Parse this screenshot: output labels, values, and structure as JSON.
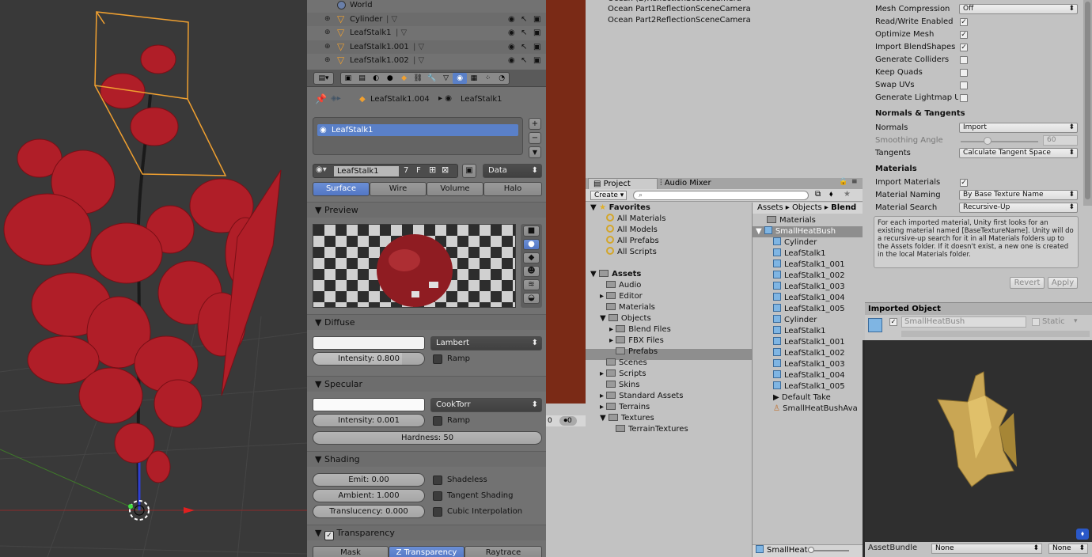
{
  "outliner": {
    "rows": [
      {
        "name": "World",
        "vertex": false
      },
      {
        "name": "Cylinder",
        "vertex": true
      },
      {
        "name": "LeafStalk1",
        "vertex": true
      },
      {
        "name": "LeafStalk1.001",
        "vertex": true
      },
      {
        "name": "LeafStalk1.002",
        "vertex": true
      }
    ]
  },
  "props": {
    "breadcrumb_object": "LeafStalk1.004",
    "breadcrumb_material": "LeafStalk1",
    "slot_item": "LeafStalk1",
    "material_name": "LeafStalk1",
    "user_count": "7",
    "fake_user": "F",
    "data_dropdown": "Data",
    "tabs": [
      "Surface",
      "Wire",
      "Volume",
      "Halo"
    ],
    "preview_label": "Preview",
    "diffuse": {
      "label": "Diffuse",
      "shader": "Lambert",
      "intensity": "Intensity: 0.800",
      "intensity_value": 0.8,
      "ramp": "Ramp"
    },
    "specular": {
      "label": "Specular",
      "shader": "CookTorr",
      "intensity": "Intensity: 0.001",
      "ramp": "Ramp",
      "hardness": "Hardness: 50"
    },
    "shading": {
      "label": "Shading",
      "emit": "Emit: 0.00",
      "ambient": "Ambient: 1.000",
      "translucency": "Translucency: 0.000",
      "shadeless": "Shadeless",
      "tangent": "Tangent Shading",
      "cubic": "Cubic Interpolation"
    },
    "transparency": {
      "label": "Transparency",
      "modes": [
        "Mask",
        "Z Transparency",
        "Raytrace"
      ]
    }
  },
  "timeline": {
    "frame_start": "0",
    "frame_current": "0"
  },
  "hierarchy": {
    "items": [
      "Ocean Part1ReflectionSceneCamera",
      "Ocean Part2ReflectionSceneCamera"
    ]
  },
  "project": {
    "tab_project": "Project",
    "tab_audio": "Audio Mixer",
    "create_label": "Create",
    "favorites_label": "Favorites",
    "favorites": [
      "All Materials",
      "All Models",
      "All Prefabs",
      "All Scripts"
    ],
    "assets_label": "Assets",
    "assets_tree": [
      "Audio",
      "Editor",
      "Materials",
      "Objects",
      "Blend Files",
      "FBX Files",
      "Prefabs",
      "Scenes",
      "Scripts",
      "Skins",
      "Standard Assets",
      "Terrains",
      "Textures",
      "TerrainTextures"
    ],
    "breadcrumb": [
      "Assets",
      "Objects",
      "Blend"
    ],
    "contents_folder": "Materials",
    "contents_root": "SmallHeatBush",
    "contents_children": [
      "Cylinder",
      "LeafStalk1",
      "LeafStalk1_001",
      "LeafStalk1_002",
      "LeafStalk1_003",
      "LeafStalk1_004",
      "LeafStalk1_005",
      "Cylinder",
      "LeafStalk1",
      "LeafStalk1_001",
      "LeafStalk1_002",
      "LeafStalk1_003",
      "LeafStalk1_004",
      "LeafStalk1_005"
    ],
    "default_take": "Default Take",
    "avatar": "SmallHeatBushAva",
    "footer_item": "SmallHeat"
  },
  "inspector": {
    "mesh_compression": "Mesh Compression",
    "mesh_compression_value": "Off",
    "read_write": "Read/Write Enabled",
    "optimize": "Optimize Mesh",
    "blendshapes": "Import BlendShapes",
    "colliders": "Generate Colliders",
    "keep_quads": "Keep Quads",
    "swap_uvs": "Swap UVs",
    "lightmap": "Generate Lightmap U",
    "normals_header": "Normals & Tangents",
    "normals": "Normals",
    "normals_value": "Import",
    "smoothing": "Smoothing Angle",
    "smoothing_value": "60",
    "tangents": "Tangents",
    "tangents_value": "Calculate Tangent Space",
    "materials_header": "Materials",
    "import_materials": "Import Materials",
    "material_naming": "Material Naming",
    "material_naming_value": "By Base Texture Name",
    "material_search": "Material Search",
    "material_search_value": "Recursive-Up",
    "help_text": "For each imported material, Unity first looks for an existing material named [BaseTextureName]. Unity will do a recursive-up search for it in all Materials folders up to the Assets folder. If it doesn't exist, a new one is created in the local Materials folder.",
    "revert": "Revert",
    "apply": "Apply",
    "imported_object": "Imported Object",
    "object_name": "SmallHeatBush",
    "static": "Static"
  },
  "bundle": {
    "label": "AssetBundle",
    "value1": "None",
    "value2": "None"
  },
  "colors": {
    "leaf": "#b01e28",
    "selection": "#f0a030",
    "unity_bg": "#c2c2c2",
    "blender_bg": "#727272"
  }
}
